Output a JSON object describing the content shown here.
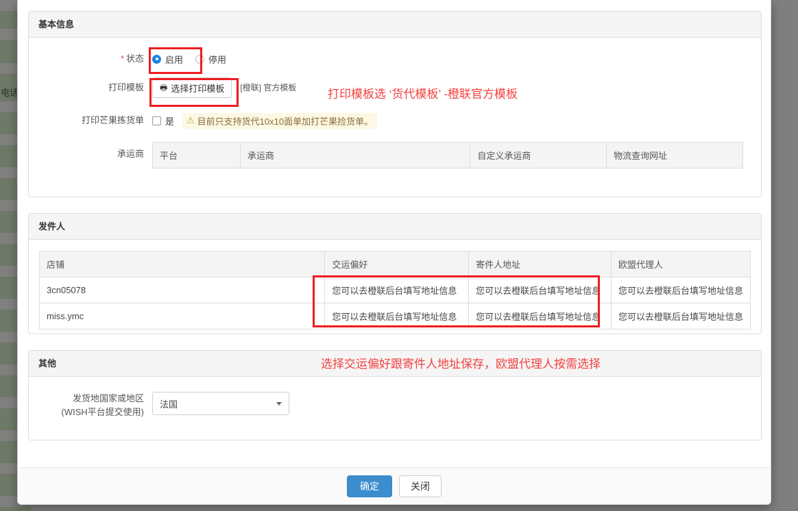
{
  "background": {
    "label": "电话"
  },
  "modal": {
    "sections": {
      "basic": {
        "title": "基本信息",
        "status": {
          "label": "状态",
          "required_mark": "*",
          "options": [
            {
              "label": "启用",
              "selected": true
            },
            {
              "label": "停用",
              "selected": false
            }
          ]
        },
        "print_template": {
          "label": "打印模板",
          "button_label": "选择打印模板",
          "button_icon": "printer-icon",
          "selected_template": "[橙联] 官方模板"
        },
        "mango_picklist": {
          "label": "打印芒果拣货单",
          "checkbox_label": "是",
          "checked": false,
          "warning_icon": "warning-triangle-icon",
          "warning_text": "目前只支持货代10x10面单加打芒果捡货单。"
        },
        "carrier": {
          "label": "承运商",
          "columns": [
            "平台",
            "承运商",
            "自定义承运商",
            "物流查询网址"
          ],
          "rows": []
        }
      },
      "sender": {
        "title": "发件人",
        "columns": [
          "店铺",
          "交运偏好",
          "寄件人地址",
          "欧盟代理人"
        ],
        "rows": [
          {
            "shop": "3cn05078",
            "shipping_preference": "您可以去橙联后台填写地址信息",
            "sender_address": "您可以去橙联后台填写地址信息",
            "eu_agent": "您可以去橙联后台填写地址信息"
          },
          {
            "shop": "miss.ymc",
            "shipping_preference": "您可以去橙联后台填写地址信息",
            "sender_address": "您可以去橙联后台填写地址信息",
            "eu_agent": "您可以去橙联后台填写地址信息"
          }
        ]
      },
      "other": {
        "title": "其他",
        "country": {
          "label_line1": "发货地国家或地区",
          "label_line2": "(WISH平台提交使用)",
          "selected": "法国"
        }
      }
    },
    "footer": {
      "confirm": "确定",
      "close": "关闭"
    }
  },
  "annotations": {
    "note_print_template": "打印模板选 ‘货代模板’ -橙联官方模板",
    "note_sender": "选择交运偏好跟寄件人地址保存，欧盟代理人按需选择",
    "box_color": "#ee1c20",
    "text_color": "#f4413f"
  }
}
